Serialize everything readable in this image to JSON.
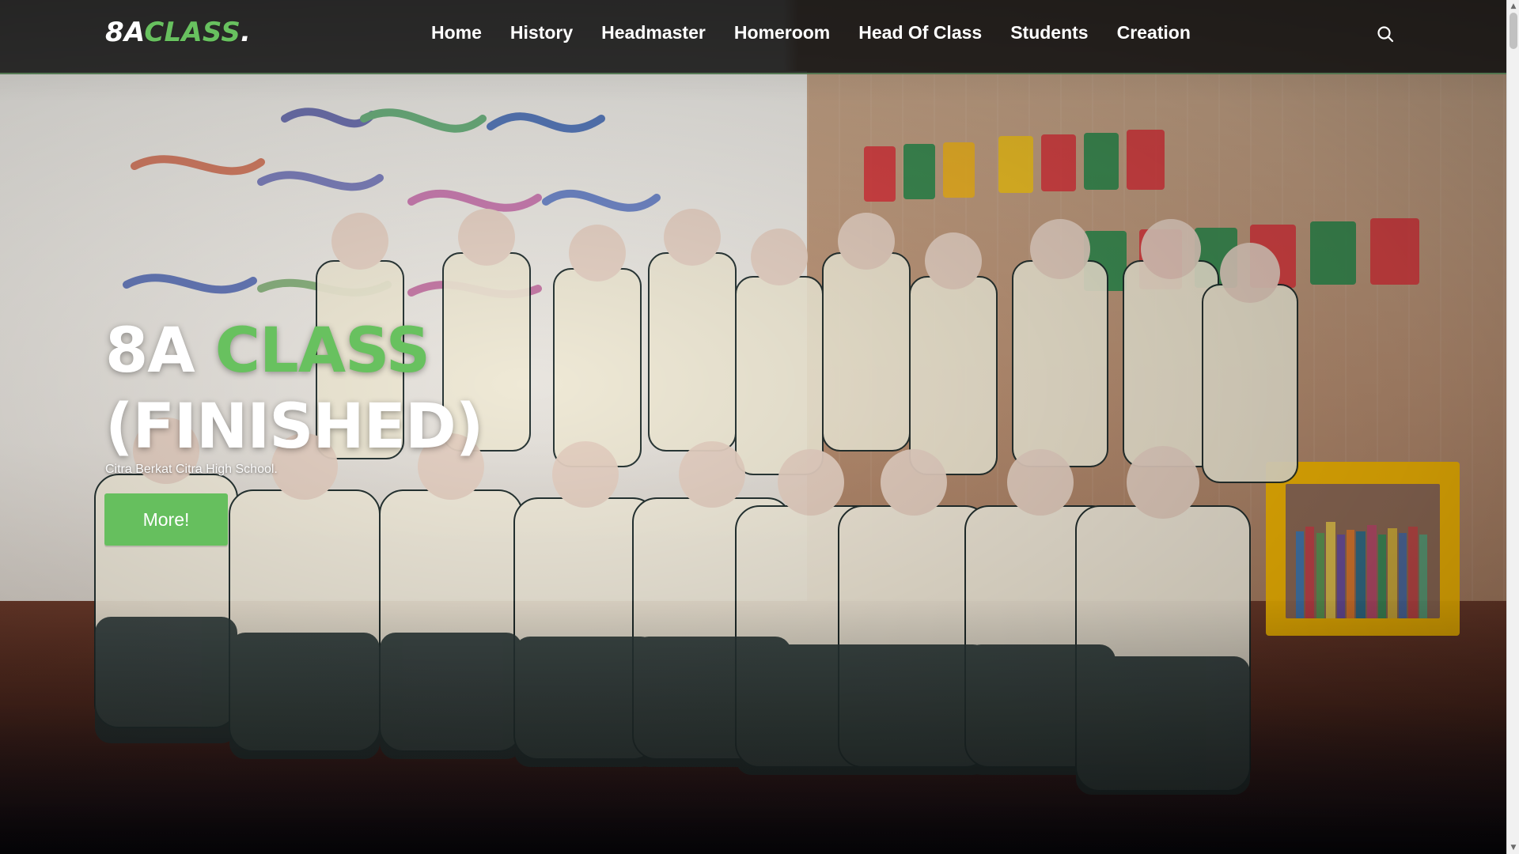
{
  "site": {
    "logo": {
      "part1": "8A",
      "part2": "CLASS",
      "part3": "."
    },
    "nav": {
      "items": [
        {
          "label": "Home"
        },
        {
          "label": "History"
        },
        {
          "label": "Headmaster"
        },
        {
          "label": "Homeroom"
        },
        {
          "label": "Head Of Class"
        },
        {
          "label": "Students"
        },
        {
          "label": "Creation"
        }
      ]
    },
    "search": {
      "icon": "search-icon"
    }
  },
  "hero": {
    "title_line1_part1": "8A",
    "title_line1_part2": "CLASS",
    "title_line2": "(FINISHED)",
    "subtitle": "Citra Berkat Citra High School.",
    "button_label": "More!"
  },
  "colors": {
    "accent_green": "#68c15f",
    "header_bg": "#121212",
    "text_white": "#ffffff"
  },
  "scrollbar": {
    "up_glyph": "▲",
    "down_glyph": "▼"
  }
}
